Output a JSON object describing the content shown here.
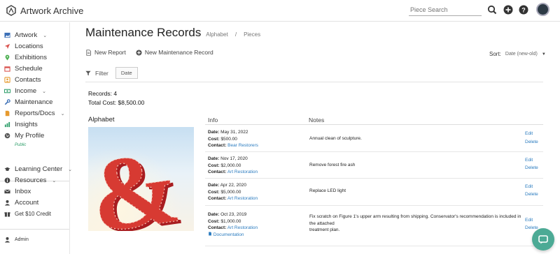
{
  "app": {
    "name": "Artwork Archive"
  },
  "search": {
    "placeholder": "Piece Search"
  },
  "sidebar": {
    "items": [
      {
        "label": "Artwork",
        "icon": "image-icon",
        "color": "#3b6fb6",
        "chevron": true
      },
      {
        "label": "Locations",
        "icon": "location-arrow-icon",
        "color": "#d9534f",
        "chevron": false
      },
      {
        "label": "Exhibitions",
        "icon": "map-pin-icon",
        "color": "#4caf50",
        "chevron": false
      },
      {
        "label": "Schedule",
        "icon": "calendar-icon",
        "color": "#d9534f",
        "chevron": false
      },
      {
        "label": "Contacts",
        "icon": "contacts-icon",
        "color": "#e69a2e",
        "chevron": false
      },
      {
        "label": "Income",
        "icon": "money-icon",
        "color": "#2e9e6a",
        "chevron": true
      },
      {
        "label": "Maintenance",
        "icon": "wrench-icon",
        "color": "#3b6fb6",
        "chevron": false
      },
      {
        "label": "Reports/Docs",
        "icon": "document-icon",
        "color": "#e69a2e",
        "chevron": true
      },
      {
        "label": "Insights",
        "icon": "chart-icon",
        "color": "#2e9e6a",
        "chevron": false
      },
      {
        "label": "My Profile",
        "icon": "globe-icon",
        "color": "#555555",
        "chevron": false
      }
    ],
    "profile_sub": "Public",
    "bottom": [
      {
        "label": "Learning Center",
        "icon": "graduation-cap-icon",
        "chevron": true
      },
      {
        "label": "Resources",
        "icon": "info-icon",
        "chevron": true
      },
      {
        "label": "Inbox",
        "icon": "envelope-icon",
        "chevron": false
      },
      {
        "label": "Account",
        "icon": "user-icon",
        "chevron": false
      },
      {
        "label": "Get $10 Credit",
        "icon": "gift-icon",
        "chevron": false
      }
    ],
    "admin": {
      "label": "Admin",
      "icon": "user-icon"
    }
  },
  "page": {
    "title": "Maintenance Records",
    "breadcrumbs": [
      "Alphabet",
      "Pieces"
    ],
    "actions": {
      "new_report": "New Report",
      "new_record": "New Maintenance Record"
    },
    "sort_label": "Sort:",
    "sort_value": "Date (new-old)",
    "filter_label": "Filter",
    "filter_chip": "Date",
    "records_count": "Records: 4",
    "total_cost": "Total Cost: $8,500.00"
  },
  "artwork": {
    "title": "Alphabet"
  },
  "table": {
    "headers": {
      "info": "Info",
      "notes": "Notes"
    },
    "labels": {
      "date": "Date:",
      "cost": "Cost:",
      "contact": "Contact:"
    },
    "edit_label": "Edit",
    "delete_label": "Delete",
    "rows": [
      {
        "date": "May 31, 2022",
        "cost": "$500.00",
        "contact": "Bear Restorers",
        "notes": "Annual clean of sculpture."
      },
      {
        "date": "Nov 17, 2020",
        "cost": "$2,000.00",
        "contact": "Art Restoration",
        "notes": "Remove forest fire ash"
      },
      {
        "date": "Apr 22, 2020",
        "cost": "$5,000.00",
        "contact": "Art Restoration",
        "notes": "Replace LED light"
      },
      {
        "date": "Oct 23, 2019",
        "cost": "$1,000.00",
        "contact": "Art Restoration",
        "doc": "Documentation",
        "notes_line1": "Fix scratch on Figure 1's upper arm resulting from shipping. Conservator's recommendation is included in",
        "notes_line2": "the attached",
        "notes_line3": "treatment plan."
      }
    ]
  },
  "colors": {
    "link": "#2a7bbf",
    "chat": "#4caa95"
  }
}
